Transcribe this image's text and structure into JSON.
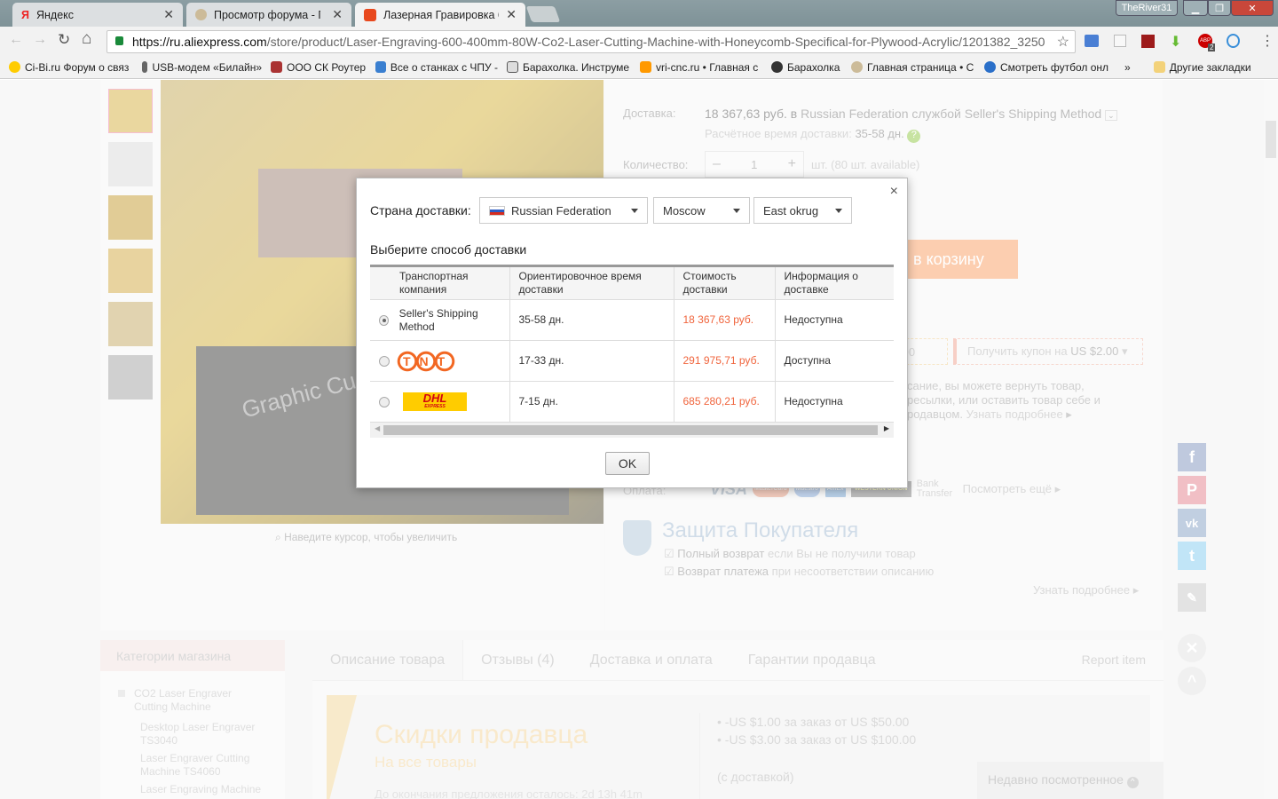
{
  "browser": {
    "tabs": [
      {
        "label": "Яндекс",
        "icon": "yandex-icon"
      },
      {
        "label": "Просмотр форума - Пр",
        "icon": "forum-icon"
      },
      {
        "label": "Лазерная Гравировка 6",
        "icon": "aliexpress-icon"
      }
    ],
    "user": "TheRiver31",
    "url_domain": "https://ru.aliexpress.com",
    "url_path": "/store/product/Laser-Engraving-600-400mm-80W-Co2-Laser-Cutting-Machine-with-Honeycomb-Specifical-for-Plywood-Acrylic/1201382_3250",
    "extensions": {
      "abp_badge": "2"
    },
    "bookmarks": [
      "Ci-Bi.ru Форум о связ",
      "USB-модем «Билайн»",
      "ООО СК Роутер",
      "Все о станках с ЧПУ -",
      "Барахолка. Инструме",
      "vri-cnc.ru • Главная с",
      "Барахолка",
      "Главная страница • С",
      "Смотреть футбол онл"
    ],
    "bookmarks_more": "»",
    "other_bookmarks": "Другие закладки"
  },
  "product": {
    "zoom_hint": "Наведите курсор, чтобы увеличить",
    "watermark": "Graphic Cu",
    "delivery_label": "Доставка:",
    "delivery_price": "18 367,63 руб.",
    "delivery_in": "в",
    "delivery_country": "Russian Federation",
    "delivery_service_prefix": "службой",
    "delivery_method": "Seller's Shipping Method",
    "eta_label": "Расчётное время доставки:",
    "eta_value": "35-58 дн.",
    "qty_label": "Количество:",
    "qty_value": "1",
    "qty_unit": "шт. (80 шт. available)",
    "cart_button": "в корзину",
    "coupon1": ",00",
    "coupon2_prefix": "Получить купон на",
    "coupon2_value": "US $2.00",
    "return_lines": [
      "сание, вы можете вернуть товар,",
      "ресылки, или оставить товар себе и",
      "родавцом."
    ],
    "learn_more": "Узнать подробнее",
    "payment_label": "Оплата:",
    "payment_methods": [
      "VISA",
      "MasterCard",
      "Maestro",
      "AmEx",
      "WESTERN UNION",
      "Bank Transfer"
    ],
    "payment_more": "Посмотреть ещё",
    "protection_title": "Защита Покупателя",
    "protection_items": [
      {
        "bold": "Полный возврат",
        "text": "если Вы не получили товар"
      },
      {
        "bold": "Возврат платежа",
        "text": "при несоответствии описанию"
      }
    ],
    "protection_more": "Узнать подробнее"
  },
  "store": {
    "categories_title": "Категории магазина",
    "categories": [
      "CO2 Laser Engraver Cutting Machine",
      "Desktop Laser Engraver TS3040",
      "Laser Engraver Cutting Machine TS4060",
      "Laser Engraving Machine"
    ]
  },
  "tabs": {
    "items": [
      "Описание товара",
      "Отзывы (4)",
      "Доставка и оплата",
      "Гарантии продавца"
    ],
    "report": "Report item"
  },
  "promo": {
    "title": "Скидки продавца",
    "subtitle": "На все товары",
    "countdown": "До окончания предложения осталось: 2d 13h 41m",
    "discounts": [
      "-US $1.00 за заказ от US $50.00",
      "-US $3.00 за заказ от US $100.00"
    ],
    "note": "(с доставкой)"
  },
  "recent": "Недавно посмотренное",
  "modal": {
    "country_label": "Страна доставки:",
    "country": "Russian Federation",
    "city": "Moscow",
    "district": "East okrug",
    "method_title": "Выберите способ доставки",
    "headers": [
      "Транспортная компания",
      "Ориентировочное время доставки",
      "Стоимость доставки",
      "Информация о доставке"
    ],
    "rows": [
      {
        "carrier": "Seller's Shipping Method",
        "time": "35-58 дн.",
        "cost": "18 367,63 руб.",
        "info": "Недоступна",
        "selected": true
      },
      {
        "carrier": "TNT",
        "time": "17-33 дн.",
        "cost": "291 975,71 руб.",
        "info": "Доступна",
        "selected": false
      },
      {
        "carrier": "DHL",
        "carrier_sub": "EXPRESS",
        "time": "7-15 дн.",
        "cost": "685 280,21 руб.",
        "info": "Недоступна",
        "selected": false
      }
    ],
    "ok": "OK",
    "close": "×"
  },
  "colors": {
    "price": "#f0643c",
    "cart": "#f9a66f",
    "tnt": "#f26722",
    "dhl_yellow": "#ffcc00",
    "dhl_red": "#d40511"
  }
}
